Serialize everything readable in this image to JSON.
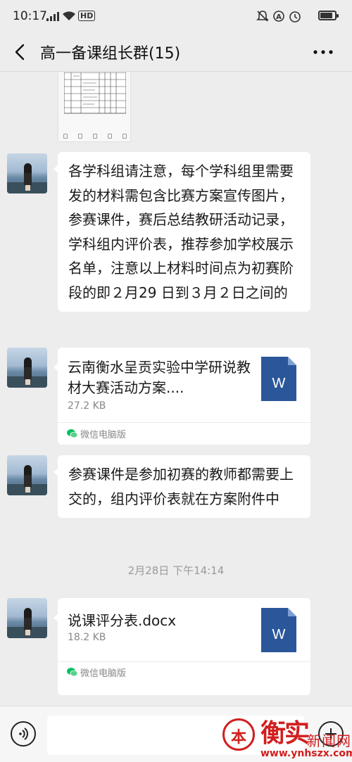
{
  "status_bar": {
    "time": "10:17",
    "network_label": "HD",
    "icons": [
      "signal-icon",
      "wifi-icon",
      "mute-bell-icon",
      "alarm-icon",
      "clock-icon",
      "battery-icon"
    ],
    "battery_level": 0.85
  },
  "header": {
    "title": "高一备课组长群(15)",
    "back_icon": "chevron-left-icon",
    "more_icon": "more-dots-icon"
  },
  "messages": [
    {
      "type": "image",
      "description_icon": "document-thumbnail"
    },
    {
      "type": "text",
      "text": "各学科组请注意，每个学科组里需要发的材料需包含比赛方案宣传图片，参赛课件，赛后总结教研活动记录，学科组内评价表，推荐参加学校展示名单，注意以上材料时间点为初赛阶段的即２月29 日到３月２日之间的"
    },
    {
      "type": "file",
      "name": "云南衡水呈贡实验中学研说教材大赛活动方案....",
      "size": "27.2 KB",
      "source": "微信电脑版",
      "file_icon_letter": "W"
    },
    {
      "type": "text",
      "text": "参赛课件是参加初赛的教师都需要上交的，组内评价表就在方案附件中"
    },
    {
      "type": "timestamp",
      "text": "2月28日 下午14:14"
    },
    {
      "type": "file",
      "name": "说课评分表.docx",
      "size": "18.2 KB",
      "source": "微信电脑版",
      "file_icon_letter": "W"
    }
  ],
  "input_bar": {
    "placeholder": "",
    "voice_icon": "voice-icon",
    "emoji_icon": "plus-icon"
  },
  "watermark": {
    "seal_char": "本",
    "big_text": "衡实",
    "news_text": "新闻网",
    "url": "www.ynhszx.com"
  },
  "colors": {
    "background": "#ededed",
    "bubble": "#ffffff",
    "word_blue": "#2b579a",
    "watermark_red": "#d11f1f",
    "wechat_green": "#07c160"
  }
}
